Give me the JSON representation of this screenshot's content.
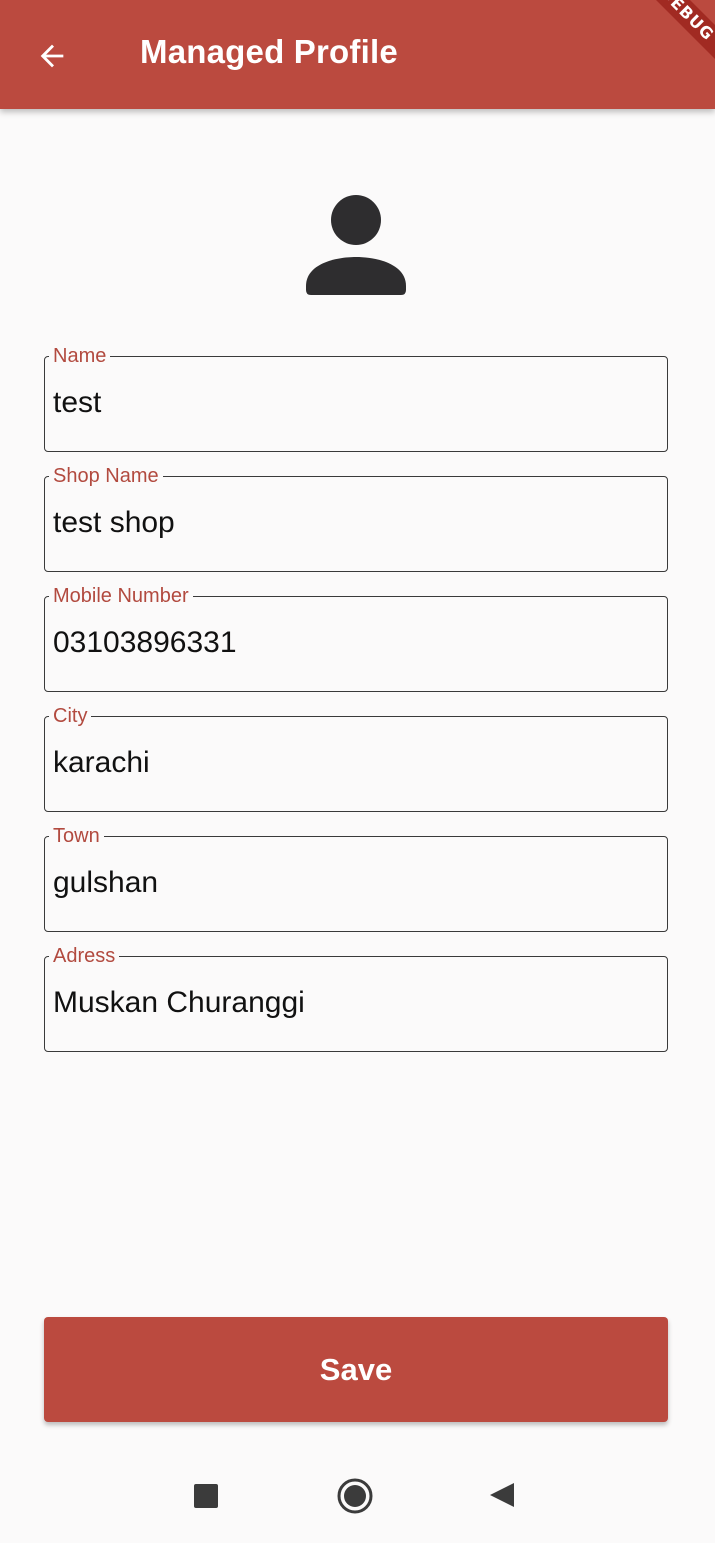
{
  "app_bar": {
    "title": "Managed Profile",
    "back_icon": "arrow-back-icon",
    "background_color": "#bb4a3f",
    "debug_banner": "DEBUG"
  },
  "avatar_icon": "person-icon",
  "fields": [
    {
      "label": "Name",
      "value": "test"
    },
    {
      "label": "Shop Name",
      "value": "test shop"
    },
    {
      "label": "Mobile Number",
      "value": "03103896331"
    },
    {
      "label": "City",
      "value": "karachi"
    },
    {
      "label": "Town",
      "value": "gulshan"
    },
    {
      "label": "Adress",
      "value": "Muskan Churanggi"
    }
  ],
  "save_button": {
    "label": "Save",
    "color": "#bb4a3f"
  },
  "system_nav": {
    "recents_icon": "square-recents-icon",
    "home_icon": "circle-home-icon",
    "back_icon": "triangle-back-icon"
  }
}
